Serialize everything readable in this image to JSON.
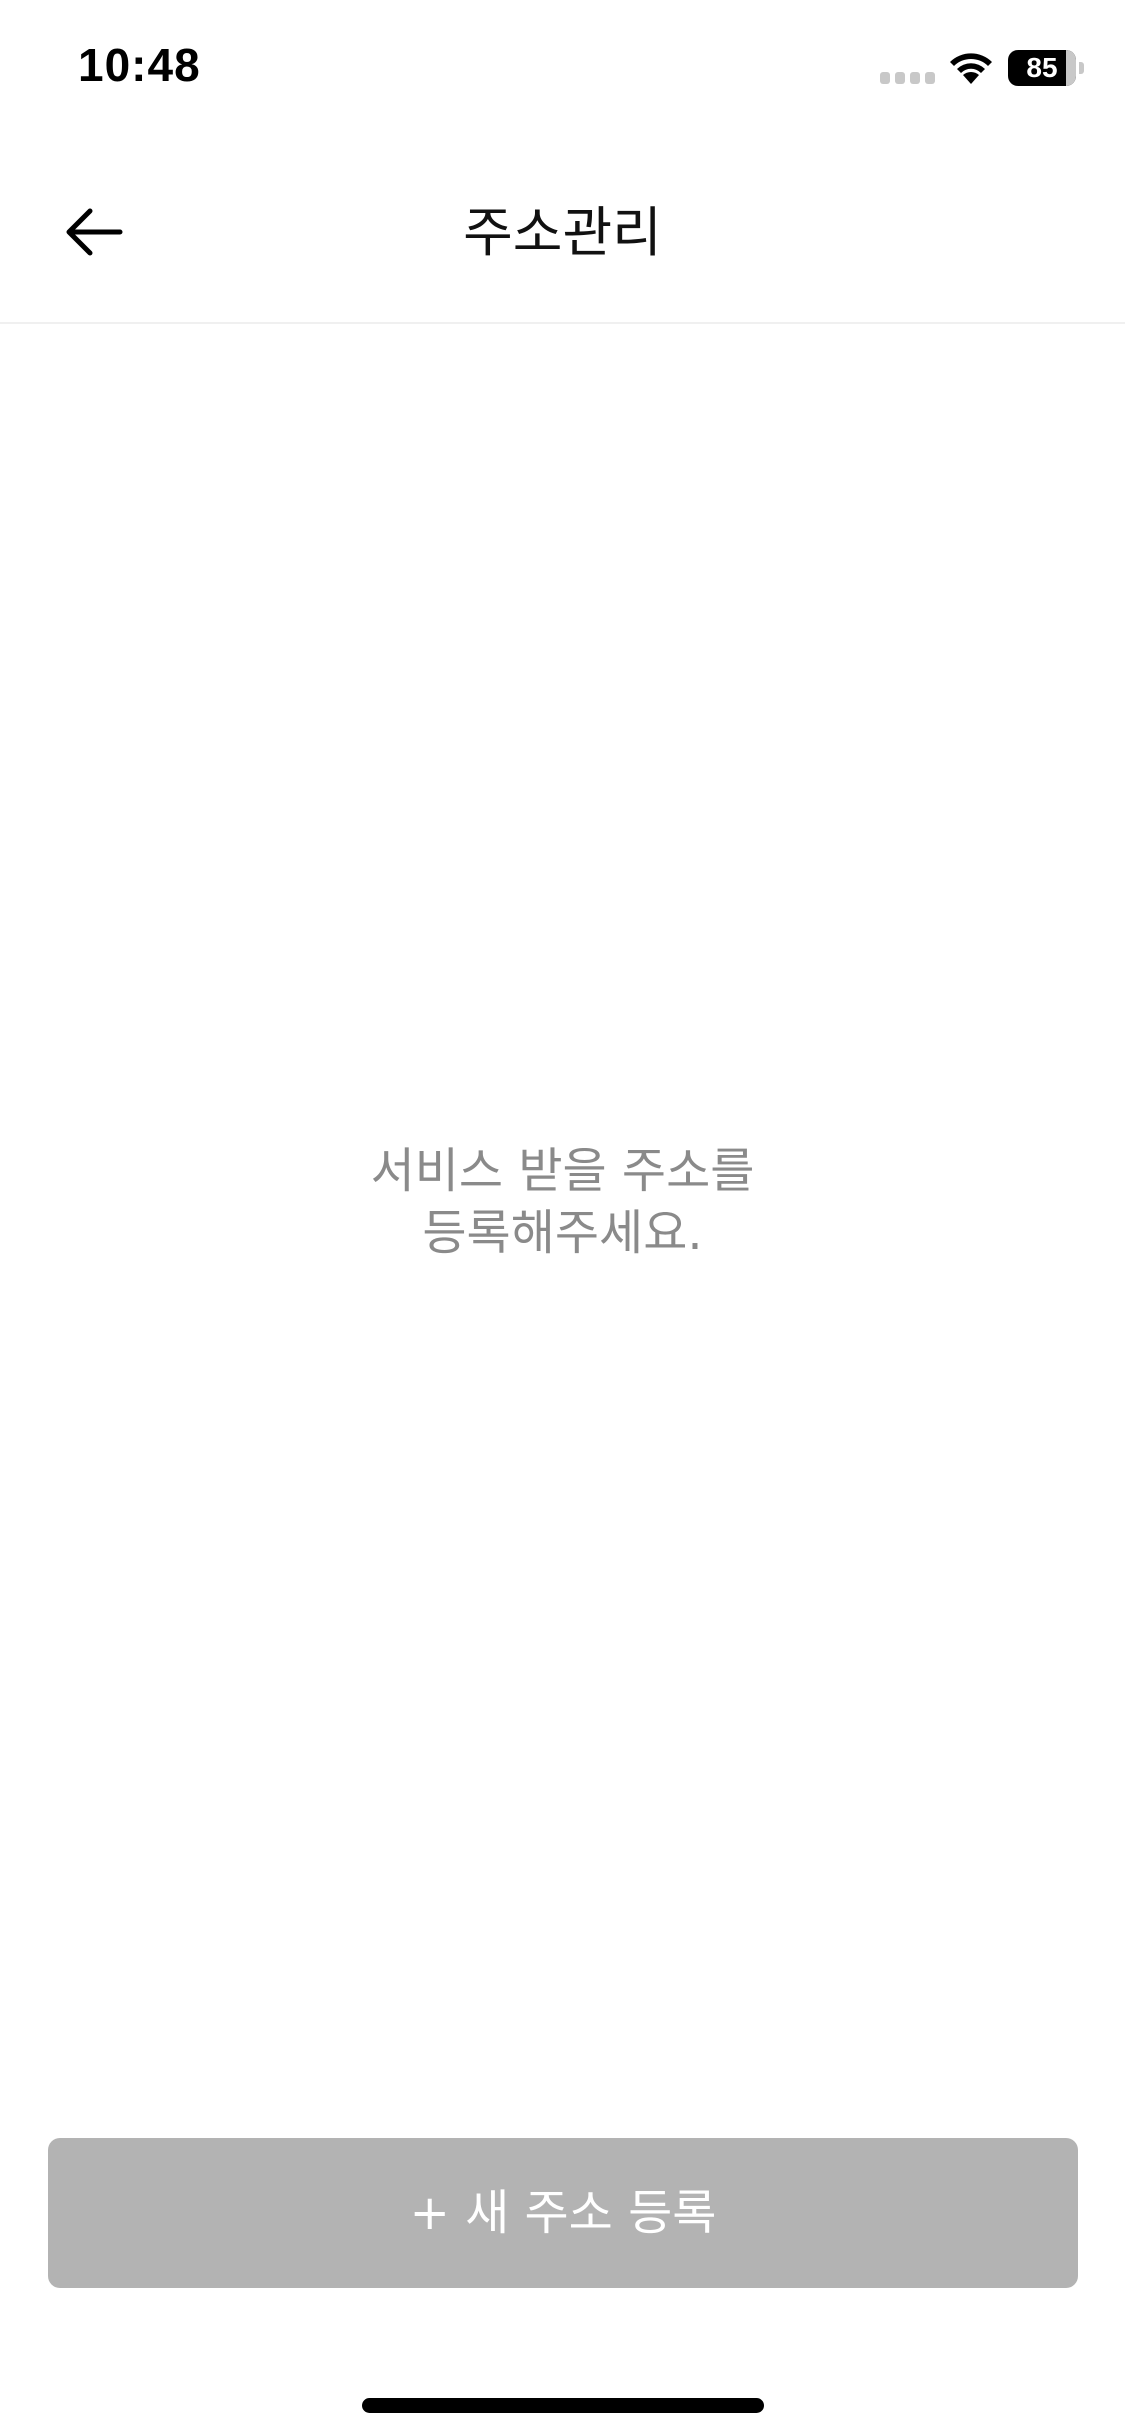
{
  "status_bar": {
    "time": "10:48",
    "battery_level": "85",
    "battery_fraction": 0.85,
    "signal_icon": "cellular-signal-icon",
    "wifi_icon": "wifi-icon"
  },
  "nav": {
    "back_icon": "arrow-left-icon",
    "title": "주소관리"
  },
  "empty_state": {
    "line1": "서비스 받을 주소를",
    "line2": "등록해주세요."
  },
  "actions": {
    "add_address_label": "+ 새 주소 등록"
  },
  "colors": {
    "button_disabled": "#b3b3b3",
    "message_text": "#8a8a8a",
    "divider": "#f0f0f0"
  }
}
